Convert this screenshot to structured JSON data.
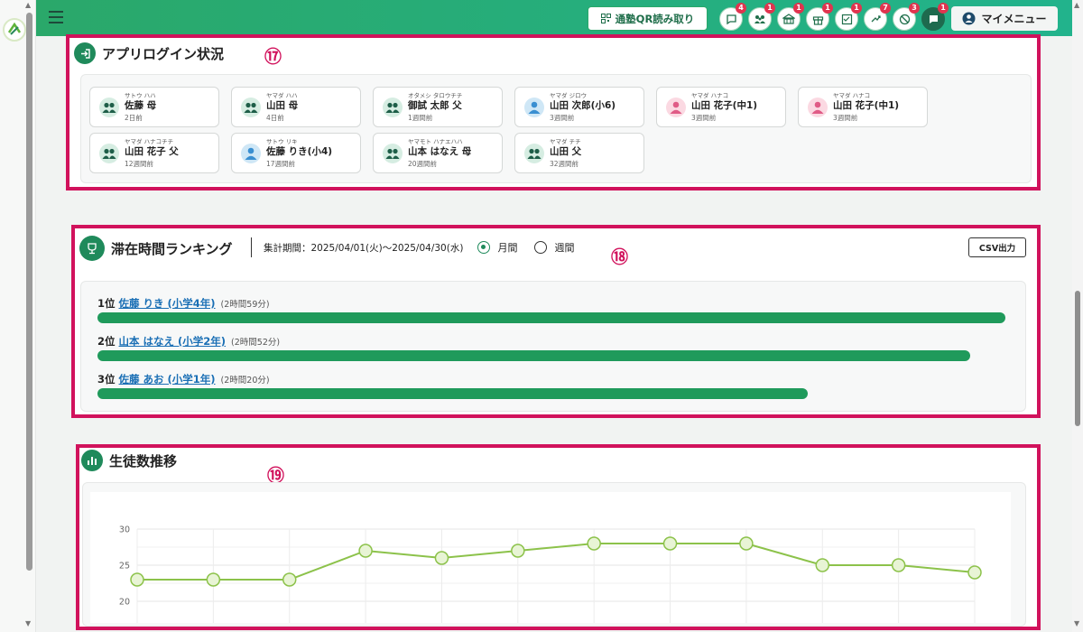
{
  "topbar": {
    "qr_label": "通塾QR読み取り",
    "menu_label": "マイメニュー",
    "icons": [
      {
        "name": "message-icon",
        "badge": "4"
      },
      {
        "name": "family-icon",
        "badge": "1"
      },
      {
        "name": "school-icon",
        "badge": "1"
      },
      {
        "name": "gift-icon",
        "badge": "1"
      },
      {
        "name": "checklist-icon",
        "badge": "1"
      },
      {
        "name": "arrows-icon",
        "badge": "7"
      },
      {
        "name": "cancel-icon",
        "badge": "3"
      },
      {
        "name": "chat-icon",
        "badge": "1"
      }
    ]
  },
  "login_section": {
    "title": "アプリログイン状況",
    "marker": "⑰",
    "cards": [
      {
        "kana": "サトウ ハハ",
        "name": "佐藤 母",
        "ago": "2日前",
        "avatar": "family"
      },
      {
        "kana": "ヤマダ ハハ",
        "name": "山田 母",
        "ago": "4日前",
        "avatar": "family"
      },
      {
        "kana": "オタメシ タロウチチ",
        "name": "御試 太郎 父",
        "ago": "1週間前",
        "avatar": "family"
      },
      {
        "kana": "ヤマダ ジロウ",
        "name": "山田 次郎(小6)",
        "ago": "3週間前",
        "avatar": "boy"
      },
      {
        "kana": "ヤマダ ハナコ",
        "name": "山田 花子(中1)",
        "ago": "3週間前",
        "avatar": "girl"
      },
      {
        "kana": "ヤマダ ハナコ",
        "name": "山田 花子(中1)",
        "ago": "3週間前",
        "avatar": "girl"
      },
      {
        "kana": "ヤマダ ハナコチチ",
        "name": "山田 花子 父",
        "ago": "12週間前",
        "avatar": "family"
      },
      {
        "kana": "サトウ リキ",
        "name": "佐藤 りき(小4)",
        "ago": "17週間前",
        "avatar": "boy"
      },
      {
        "kana": "ヤマモト ハナエハハ",
        "name": "山本 はなえ 母",
        "ago": "20週間前",
        "avatar": "family"
      },
      {
        "kana": "ヤマダ チチ",
        "name": "山田 父",
        "ago": "32週間前",
        "avatar": "family"
      }
    ]
  },
  "ranking_section": {
    "title": "滞在時間ランキング",
    "period": "集計期間：2025/04/01(火)～2025/04/30(水)",
    "option_month": "月間",
    "option_week": "週間",
    "selected": "month",
    "csv_label": "CSV出力",
    "marker": "⑱",
    "rows": [
      {
        "rank": "1位",
        "name": "佐藤 りき (小学4年)",
        "duration": "(2時間59分)",
        "minutes": 179
      },
      {
        "rank": "2位",
        "name": "山本 はなえ (小学2年)",
        "duration": "(2時間52分)",
        "minutes": 172
      },
      {
        "rank": "3位",
        "name": "佐藤 あお (小学1年)",
        "duration": "(2時間20分)",
        "minutes": 140
      }
    ]
  },
  "students_section": {
    "title": "生徒数推移",
    "marker": "⑲"
  },
  "chart_data": {
    "type": "line",
    "title": "",
    "yticks": [
      "30",
      "25",
      "20"
    ],
    "ylim": [
      17,
      30
    ],
    "grid": true,
    "series": [
      {
        "values": [
          23,
          23,
          23,
          27,
          26,
          27,
          28,
          28,
          28,
          25,
          25,
          24
        ]
      }
    ],
    "colors": {
      "line": "#8cc24a",
      "point_fill": "#e8f4d5"
    }
  }
}
